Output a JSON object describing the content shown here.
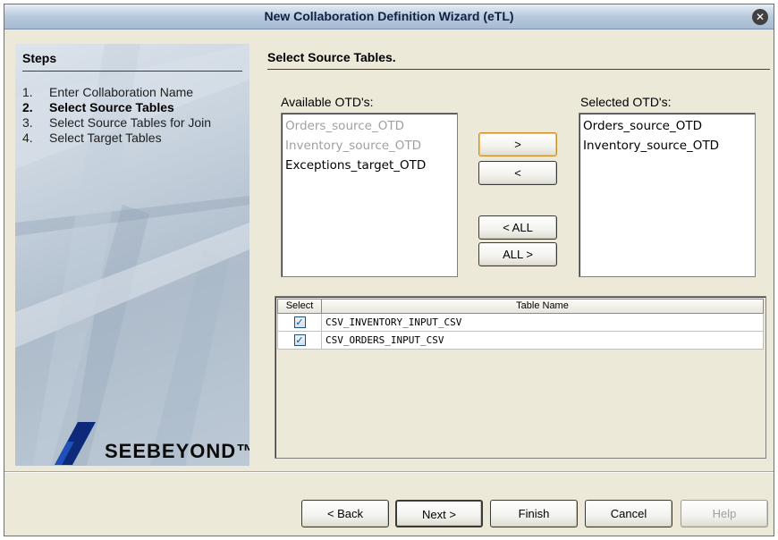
{
  "window": {
    "title": "New Collaboration Definition Wizard (eTL)"
  },
  "steps": {
    "title": "Steps",
    "items": [
      {
        "num": "1.",
        "label": "Enter Collaboration Name",
        "active": false
      },
      {
        "num": "2.",
        "label": "Select Source Tables",
        "active": true
      },
      {
        "num": "3.",
        "label": "Select Source Tables for Join",
        "active": false
      },
      {
        "num": "4.",
        "label": "Select Target Tables",
        "active": false
      }
    ]
  },
  "logo": {
    "text": "SEEBEYOND™"
  },
  "main": {
    "title": "Select Source Tables.",
    "available_label": "Available OTD's:",
    "selected_label": "Selected OTD's:",
    "available_items": [
      {
        "label": "Orders_source_OTD",
        "disabled": true
      },
      {
        "label": "Inventory_source_OTD",
        "disabled": true
      },
      {
        "label": "Exceptions_target_OTD",
        "disabled": false
      }
    ],
    "selected_items": [
      {
        "label": "Orders_source_OTD"
      },
      {
        "label": "Inventory_source_OTD"
      }
    ],
    "move_buttons": {
      "add": ">",
      "remove": "<",
      "remove_all": "< ALL",
      "add_all": "ALL >"
    }
  },
  "table": {
    "headers": {
      "select": "Select",
      "name": "Table Name"
    },
    "rows": [
      {
        "checked": true,
        "name": "CSV_INVENTORY_INPUT_CSV"
      },
      {
        "checked": true,
        "name": "CSV_ORDERS_INPUT_CSV"
      }
    ]
  },
  "footer": {
    "back": "< Back",
    "next": "Next >",
    "finish": "Finish",
    "cancel": "Cancel",
    "help": "Help"
  }
}
